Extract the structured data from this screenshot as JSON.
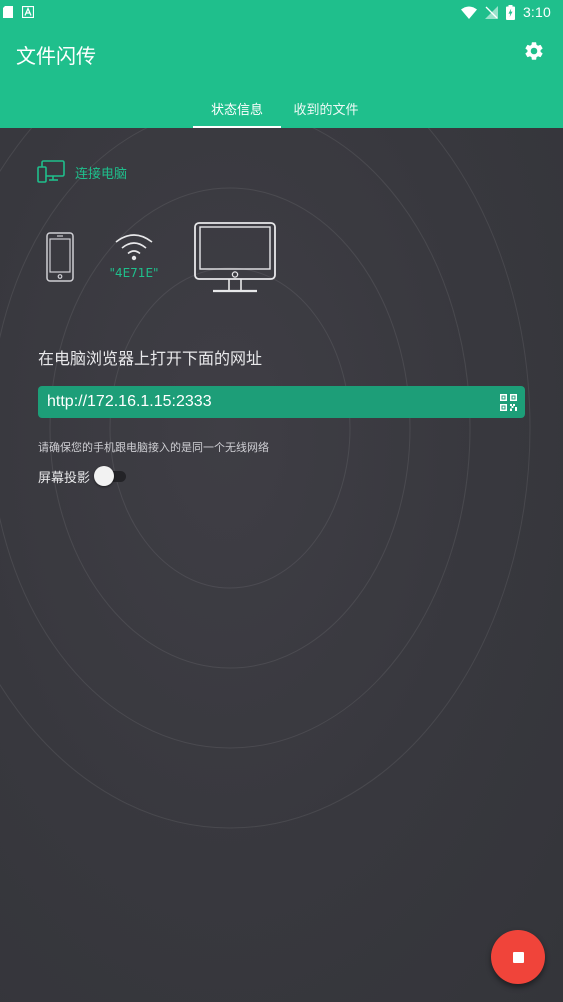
{
  "status_bar": {
    "time": "3:10"
  },
  "app_bar": {
    "title": "文件闪传"
  },
  "tabs": [
    {
      "label": "状态信息",
      "active": true
    },
    {
      "label": "收到的文件",
      "active": false
    }
  ],
  "connection": {
    "label": "连接电脑",
    "ssid": "\"4E71E\""
  },
  "instruction": "在电脑浏览器上打开下面的网址",
  "url": "http://172.16.1.15:2333",
  "note": "请确保您的手机跟电脑接入的是同一个无线网络",
  "projection": {
    "label": "屏幕投影",
    "enabled": false
  },
  "colors": {
    "accent": "#1fbf8c",
    "url_box": "#1d9e78",
    "fab": "#f0443a",
    "background": "#3a3a40"
  },
  "icons": {
    "settings": "gear-icon",
    "connect": "desktop-phone-icon",
    "phone": "phone-icon",
    "wifi": "wifi-icon",
    "monitor": "monitor-icon",
    "qr": "qr-code-icon",
    "stop": "stop-icon"
  }
}
